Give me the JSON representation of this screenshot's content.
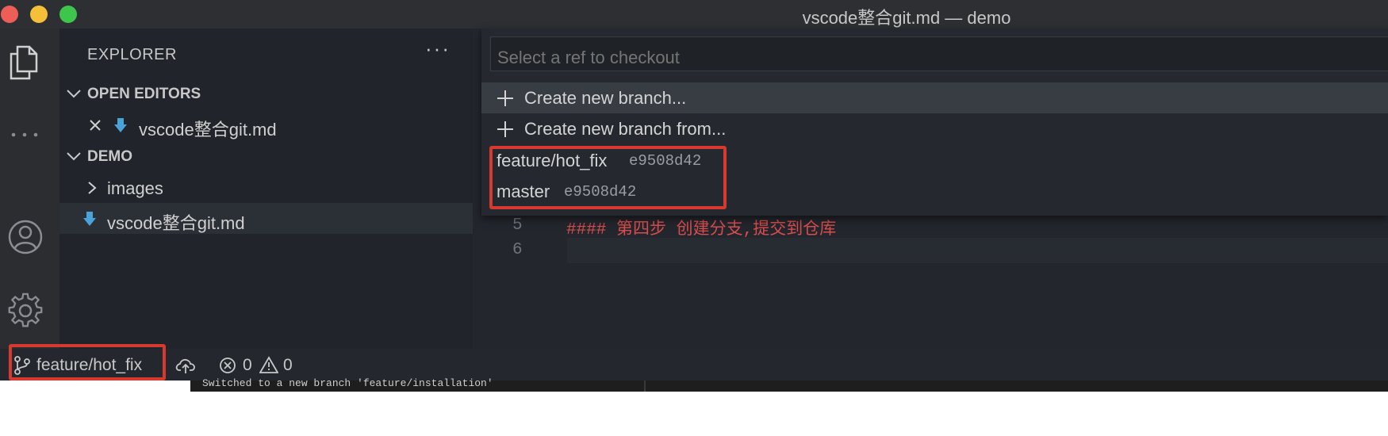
{
  "window": {
    "title": "vscode整合git.md — demo"
  },
  "activity_bar": {
    "icons": [
      "files-icon",
      "more-icon",
      "account-icon",
      "settings-gear-icon"
    ]
  },
  "sidebar": {
    "title": "EXPLORER",
    "more_actions": "···",
    "open_editors": {
      "label": "OPEN EDITORS",
      "items": [
        {
          "name": "vscode整合git.md"
        }
      ]
    },
    "workspace": {
      "label": "DEMO",
      "items": [
        {
          "name": "images",
          "kind": "folder"
        },
        {
          "name": "vscode整合git.md",
          "kind": "file"
        }
      ]
    }
  },
  "editor": {
    "lines": [
      {
        "number": "5",
        "text": "#### 第四步 创建分支,提交到仓库"
      },
      {
        "number": "6",
        "text": ""
      }
    ]
  },
  "quick_pick": {
    "placeholder": "Select a ref to checkout",
    "value": "",
    "items": [
      {
        "label": "Create new branch...",
        "description": ""
      },
      {
        "label": "Create new branch from...",
        "description": ""
      },
      {
        "label": "feature/hot_fix",
        "description": "e9508d42"
      },
      {
        "label": "master",
        "description": "e9508d42"
      }
    ]
  },
  "status_bar": {
    "branch": "feature/hot_fix",
    "errors": "0",
    "warnings": "0"
  },
  "terminal": {
    "text": "Switched to a new branch 'feature/installation'"
  },
  "colors": {
    "highlight_border": "#d63a2e",
    "heading_text": "#d94d4d",
    "accent_icon": "#4aa3d8"
  }
}
